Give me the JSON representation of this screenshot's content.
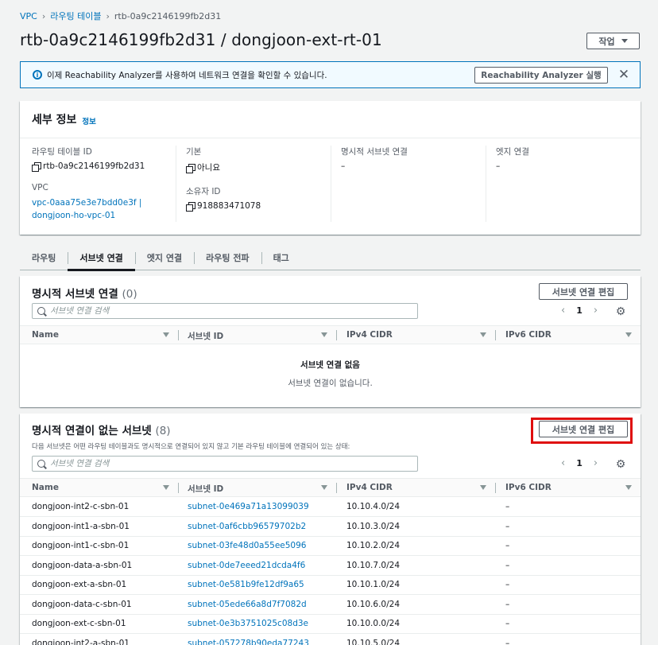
{
  "breadcrumb": {
    "items": [
      "VPC",
      "라우팅 테이블"
    ],
    "current": "rtb-0a9c2146199fb2d31"
  },
  "page": {
    "title": "rtb-0a9c2146199fb2d31 / dongjoon-ext-rt-01",
    "actions_label": "작업"
  },
  "banner": {
    "message": "이제 Reachability Analyzer를 사용하여 네트워크 연결을 확인할 수 있습니다.",
    "button_label": "Reachability Analyzer 실행",
    "close": "✕"
  },
  "details": {
    "title": "세부 정보",
    "info_link": "정보",
    "fields": {
      "route_table_id_label": "라우팅 테이블 ID",
      "route_table_id": "rtb-0a9c2146199fb2d31",
      "vpc_label": "VPC",
      "vpc_line1": "vpc-0aaa75e3e7bdd0e3f |",
      "vpc_line2": "dongjoon-ho-vpc-01",
      "main_label": "기본",
      "main_value": "아니요",
      "owner_label": "소유자 ID",
      "owner_value": "918883471078",
      "explicit_label": "명시적 서브넷 연결",
      "explicit_value": "–",
      "edge_label": "엣지 연결",
      "edge_value": "–"
    }
  },
  "tabs": [
    {
      "label": "라우팅"
    },
    {
      "label": "서브넷 연결"
    },
    {
      "label": "엣지 연결"
    },
    {
      "label": "라우팅 전파"
    },
    {
      "label": "태그"
    }
  ],
  "explicit_panel": {
    "title": "명시적 서브넷 연결",
    "count": "(0)",
    "edit_label": "서브넷 연결 편집",
    "search_placeholder": "서브넷 연결 검색",
    "page": "1",
    "columns": [
      "Name",
      "서브넷 ID",
      "IPv4 CIDR",
      "IPv6 CIDR"
    ],
    "empty_title": "서브넷 연결 없음",
    "empty_sub": "서브넷 연결이 없습니다."
  },
  "implicit_panel": {
    "title": "명시적 연결이 없는 서브넷",
    "count": "(8)",
    "edit_label": "서브넷 연결 편집",
    "description": "다음 서브넷은 어떤 라우팅 테이블과도 명시적으로 연결되어 있지 않고 기본 라우팅 테이블에 연결되어 있는 상태:",
    "search_placeholder": "서브넷 연결 검색",
    "page": "1",
    "columns": [
      "Name",
      "서브넷 ID",
      "IPv4 CIDR",
      "IPv6 CIDR"
    ],
    "rows": [
      {
        "name": "dongjoon-int2-c-sbn-01",
        "subnet": "subnet-0e469a71a13099039",
        "ipv4": "10.10.4.0/24",
        "ipv6": "–"
      },
      {
        "name": "dongjoon-int1-a-sbn-01",
        "subnet": "subnet-0af6cbb96579702b2",
        "ipv4": "10.10.3.0/24",
        "ipv6": "–"
      },
      {
        "name": "dongjoon-int1-c-sbn-01",
        "subnet": "subnet-03fe48d0a55ee5096",
        "ipv4": "10.10.2.0/24",
        "ipv6": "–"
      },
      {
        "name": "dongjoon-data-a-sbn-01",
        "subnet": "subnet-0de7eeed21dcda4f6",
        "ipv4": "10.10.7.0/24",
        "ipv6": "–"
      },
      {
        "name": "dongjoon-ext-a-sbn-01",
        "subnet": "subnet-0e581b9fe12df9a65",
        "ipv4": "10.10.1.0/24",
        "ipv6": "–"
      },
      {
        "name": "dongjoon-data-c-sbn-01",
        "subnet": "subnet-05ede66a8d7f7082d",
        "ipv4": "10.10.6.0/24",
        "ipv6": "–"
      },
      {
        "name": "dongjoon-ext-c-sbn-01",
        "subnet": "subnet-0e3b3751025c08d3e",
        "ipv4": "10.10.0.0/24",
        "ipv6": "–"
      },
      {
        "name": "dongjoon-int2-a-sbn-01",
        "subnet": "subnet-057278b90eda77243",
        "ipv4": "10.10.5.0/24",
        "ipv6": "–"
      }
    ]
  },
  "colors": {
    "link": "#0073bb",
    "highlight": "#df0e0e",
    "banner_bg": "#f1faff"
  }
}
